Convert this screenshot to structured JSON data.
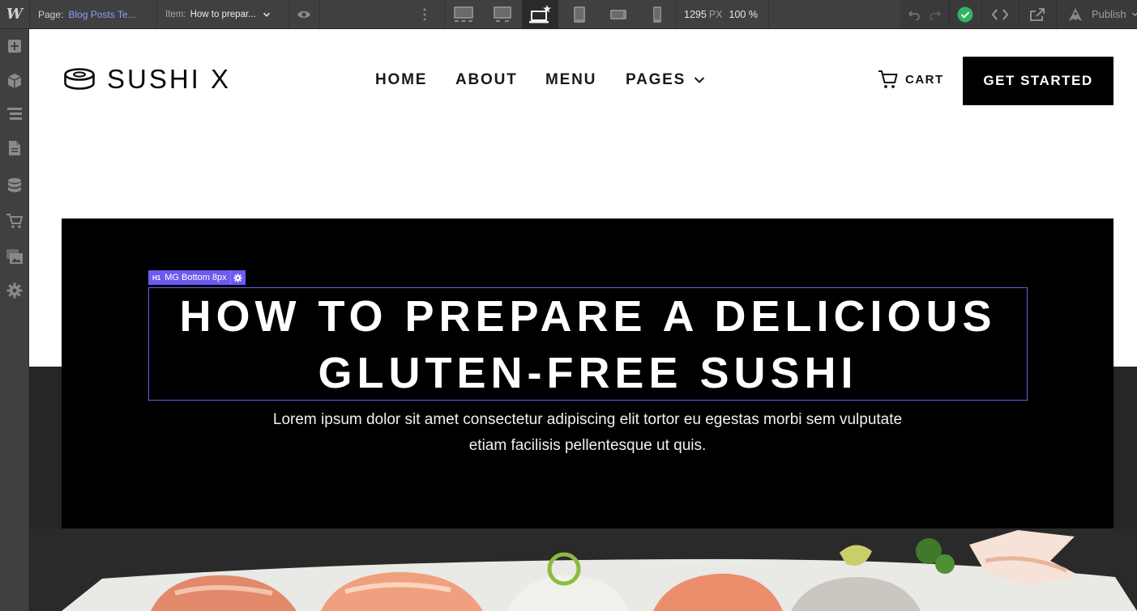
{
  "editor": {
    "logo": "W",
    "page_label": "Page:",
    "page_value": "Blog Posts Te...",
    "item_label": "Item:",
    "item_value": "How to prepar...",
    "canvas_width": "1295",
    "canvas_unit": "PX",
    "zoom": "100 %",
    "publish_label": "Publish",
    "status_color": "#2fb55f",
    "accent_color": "#6c5bf0",
    "breakpoints": [
      "desktop-xl",
      "desktop-large",
      "desktop-base",
      "tablet",
      "mobile-landscape",
      "mobile-portrait"
    ],
    "active_breakpoint": "desktop-base",
    "left_icons": [
      "add-icon",
      "symbols-icon",
      "navigator-icon",
      "pages-icon",
      "cms-icon",
      "ecommerce-icon",
      "assets-icon",
      "settings-icon"
    ]
  },
  "site": {
    "brand": "SUSHI X",
    "nav": {
      "home": "HOME",
      "about": "ABOUT",
      "menu": "MENU",
      "pages": "PAGES"
    },
    "cart": "CART",
    "cta": "GET STARTED"
  },
  "selection": {
    "tag_type": "H1",
    "tag_label": "MG Bottom 8px"
  },
  "hero": {
    "title_line1": "HOW TO PREPARE A DELICIOUS",
    "title_line2": "GLUTEN-FREE SUSHI",
    "subtitle": "Lorem ipsum dolor sit amet consectetur adipiscing elit tortor eu egestas morbi sem vulputate etiam facilisis pellentesque ut quis."
  }
}
